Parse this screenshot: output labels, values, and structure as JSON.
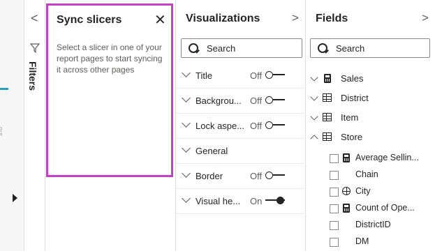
{
  "filters": {
    "label": "Filters",
    "collapse_glyph": "<",
    "axis_tick": "nur"
  },
  "sync": {
    "title": "Sync slicers",
    "close_glyph": "✕",
    "message": "Select a slicer in one of your report pages to start syncing it across other pages"
  },
  "viz": {
    "title": "Visualizations",
    "expand_glyph": ">",
    "search_placeholder": "Search",
    "cards": [
      {
        "label": "Title",
        "state": "Off"
      },
      {
        "label": "Backgrou...",
        "state": "Off"
      },
      {
        "label": "Lock aspe...",
        "state": "Off"
      },
      {
        "label": "General",
        "state": ""
      },
      {
        "label": "Border",
        "state": "Off"
      },
      {
        "label": "Visual he...",
        "state": "On"
      }
    ]
  },
  "fields": {
    "title": "Fields",
    "expand_glyph": ">",
    "search_placeholder": "Search",
    "tables": [
      {
        "name": "Sales",
        "icon": "calculator-icon",
        "expanded": false
      },
      {
        "name": "District",
        "icon": "table-icon",
        "expanded": false
      },
      {
        "name": "Item",
        "icon": "table-icon",
        "expanded": false
      },
      {
        "name": "Store",
        "icon": "table-icon",
        "expanded": true
      }
    ],
    "store_fields": [
      {
        "name": "Average Sellin...",
        "icon": "calculator-icon"
      },
      {
        "name": "Chain",
        "icon": ""
      },
      {
        "name": "City",
        "icon": "globe-icon"
      },
      {
        "name": "Count of Ope...",
        "icon": "calculator-icon"
      },
      {
        "name": "DistrictID",
        "icon": ""
      },
      {
        "name": "DM",
        "icon": ""
      }
    ]
  },
  "colors": {
    "highlight_border": "#c33fc3",
    "accent": "#2b9fb8"
  }
}
